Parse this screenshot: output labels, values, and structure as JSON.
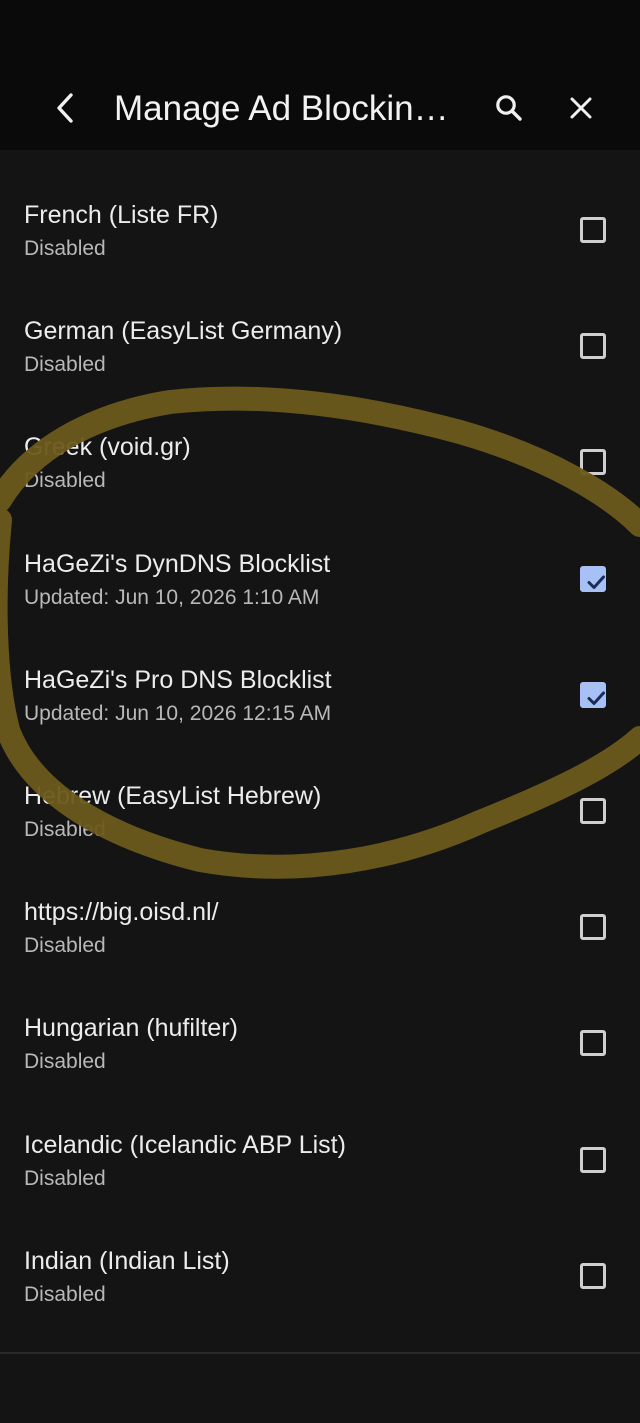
{
  "header": {
    "title": "Manage Ad Blockin…",
    "back_icon": "chevron-left-icon",
    "search_icon": "search-icon",
    "close_icon": "close-icon"
  },
  "lists": [
    {
      "name": "French (Liste FR)",
      "status": "Disabled",
      "checked": false
    },
    {
      "name": "German (EasyList Germany)",
      "status": "Disabled",
      "checked": false
    },
    {
      "name": "Greek (void.gr)",
      "status": "Disabled",
      "checked": false
    },
    {
      "name": "HaGeZi's DynDNS Blocklist",
      "status": "Updated: Jun 10, 2026 1:10 AM",
      "checked": true
    },
    {
      "name": "HaGeZi's Pro DNS Blocklist",
      "status": "Updated: Jun 10, 2026 12:15 AM",
      "checked": true
    },
    {
      "name": "Hebrew (EasyList Hebrew)",
      "status": "Disabled",
      "checked": false
    },
    {
      "name": "https://big.oisd.nl/",
      "status": "Disabled",
      "checked": false
    },
    {
      "name": "Hungarian (hufilter)",
      "status": "Disabled",
      "checked": false
    },
    {
      "name": "Icelandic (Icelandic ABP List)",
      "status": "Disabled",
      "checked": false
    },
    {
      "name": "Indian (Indian List)",
      "status": "Disabled",
      "checked": false
    }
  ],
  "colors": {
    "background": "#141414",
    "header_background": "#0a0a0a",
    "checkbox_checked": "#a7c1f6",
    "annotation_marker": "#6b5a1c"
  }
}
